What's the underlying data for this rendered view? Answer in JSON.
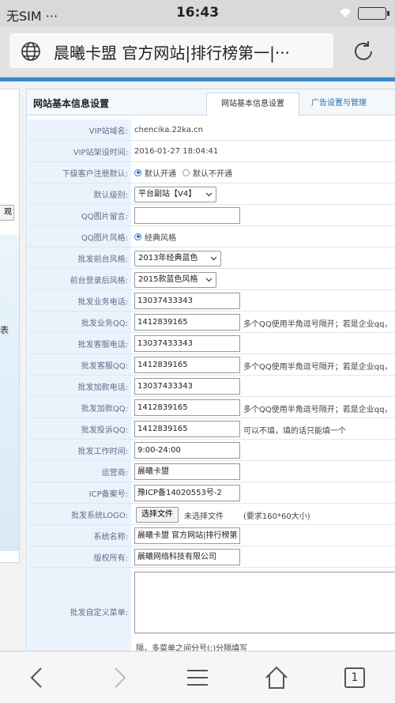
{
  "status": {
    "carrier": "无SIM ···",
    "time": "16:43"
  },
  "browser": {
    "title": "晨曦卡盟 官方网站|排行榜第一|···",
    "tabs_count": "1"
  },
  "left": {
    "button_label": "观",
    "nav_text": "表"
  },
  "panel": {
    "title": "网站基本信息设置",
    "tab_active": "网站基本信息设置",
    "tab_other": "广告设置与管理"
  },
  "form": {
    "vip_domain": {
      "label": "VIP站域名:",
      "value": "chencika.22ka.cn"
    },
    "vip_time": {
      "label": "VIP站架设时间:",
      "value": "2016-01-27 18:04:41"
    },
    "register_default": {
      "label": "下级客户注册默认:",
      "option_on": "默认开通",
      "option_off": "默认不开通"
    },
    "default_level": {
      "label": "默认级别:",
      "value": "平台副站【V4】"
    },
    "qq_image_msg": {
      "label": "QQ图片留言:",
      "value": ""
    },
    "qq_image_style": {
      "label": "QQ图片风格:",
      "option": "经典风格"
    },
    "front_style": {
      "label": "批发前台风格:",
      "value": "2013年经典蓝色"
    },
    "login_style": {
      "label": "前台登录后风格:",
      "value": "2015款蓝色风格"
    },
    "biz_phone": {
      "label": "批发业务电话:",
      "value": "13037433343"
    },
    "biz_qq": {
      "label": "批发业务QQ:",
      "value": "1412839165",
      "hint": "多个QQ使用半角逗号隔开；若是企业qq，"
    },
    "cs_phone": {
      "label": "批发客服电话:",
      "value": "13037433343"
    },
    "cs_qq": {
      "label": "批发客服QQ:",
      "value": "1412839165",
      "hint": "多个QQ使用半角逗号隔开；若是企业qq，"
    },
    "add_phone": {
      "label": "批发加款电话:",
      "value": "13037433343"
    },
    "add_qq": {
      "label": "批发加款QQ:",
      "value": "1412839165",
      "hint": "多个QQ使用半角逗号隔开；若是企业qq，"
    },
    "complaint_qq": {
      "label": "批发投诉QQ:",
      "value": "1412839165",
      "hint": "可以不填，填的话只能填一个"
    },
    "work_time": {
      "label": "批发工作时间:",
      "value": "9:00-24:00"
    },
    "operator": {
      "label": "运营商:",
      "value": "晨曦卡盟"
    },
    "icp": {
      "label": "ICP备案号:",
      "value": "豫ICP备14020553号-2"
    },
    "logo": {
      "label": "批发系统LOGO:",
      "button": "选择文件",
      "status": "未选择文件",
      "hint": "(要求160*60大小)"
    },
    "system_name": {
      "label": "系统名称:",
      "value": "晨曦卡盟 官方网站|排行榜第"
    },
    "copyright": {
      "label": "版权所有:",
      "value": "晨曦网络科技有限公司"
    },
    "custom_menu": {
      "label": "批发自定义菜单:",
      "hint": "隔，多菜单之间分号(;)分隔填写"
    }
  }
}
